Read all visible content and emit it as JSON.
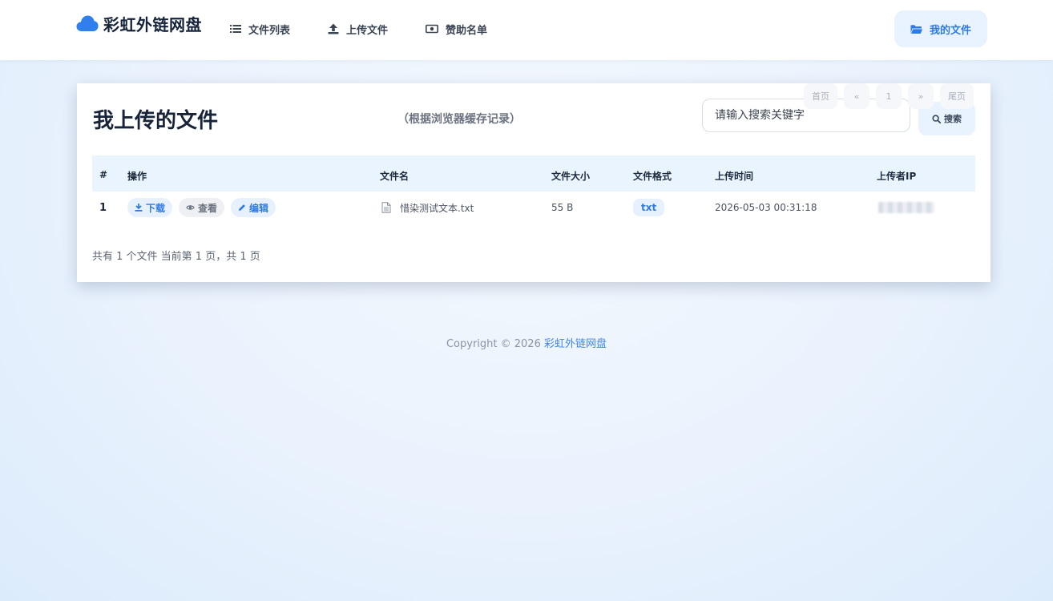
{
  "nav": {
    "brand": "彩虹外链网盘",
    "items": [
      {
        "label": "文件列表",
        "icon": "list-icon"
      },
      {
        "label": "上传文件",
        "icon": "upload-icon"
      },
      {
        "label": "赞助名单",
        "icon": "money-icon"
      }
    ],
    "my_files": "我的文件"
  },
  "card": {
    "title": "我上传的文件",
    "subtitle": "（根据浏览器缓存记录）",
    "search_placeholder": "请输入搜索关键字",
    "search_button": "搜索"
  },
  "table": {
    "headers": [
      "#",
      "操作",
      "文件名",
      "文件大小",
      "文件格式",
      "上传时间",
      "上传者IP"
    ],
    "rows": [
      {
        "index": "1",
        "actions": {
          "download": "下载",
          "view": "查看",
          "edit": "编辑"
        },
        "file_name": "惜染测试文本.txt",
        "size": "55 B",
        "format": "txt",
        "time": "2026-05-03 00:31:18"
      }
    ]
  },
  "summary": "共有 1 个文件  当前第 1 页，共 1 页",
  "pagination": {
    "first": "首页",
    "prev": "«",
    "current": "1",
    "next": "»",
    "last": "尾页"
  },
  "footer": {
    "copyright": "Copyright © 2026",
    "brand_link": "彩虹外链网盘"
  },
  "colors": {
    "accent": "#2f7ae5",
    "accent_bg": "#e9f3ff"
  }
}
